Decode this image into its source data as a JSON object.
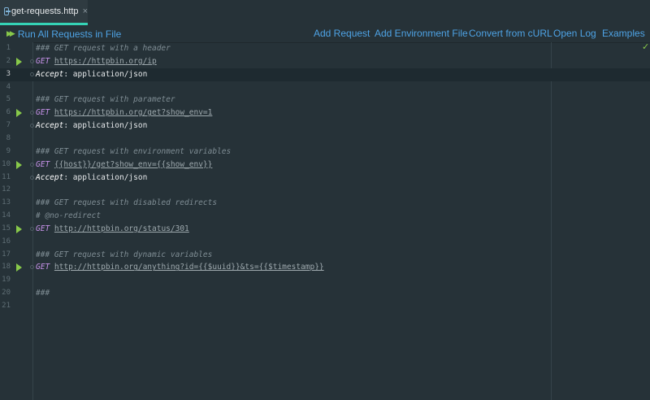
{
  "tab": {
    "title": "get-requests.http",
    "close": "×"
  },
  "toolbar": {
    "run_all": "Run All Requests in File",
    "add_request": "Add Request",
    "add_environment_file": "Add Environment File",
    "convert_from_curl": "Convert from cURL",
    "open_log": "Open Log",
    "examples": "Examples"
  },
  "editor": {
    "check": "✓",
    "lines": [
      {
        "n": "1",
        "comment": "### GET request with a header"
      },
      {
        "n": "2",
        "method": "GET",
        "url": "https://httpbin.org/ip",
        "run": true
      },
      {
        "n": "3",
        "header": "Accept",
        "value": "application/json",
        "current": true
      },
      {
        "n": "4"
      },
      {
        "n": "5",
        "comment": "### GET request with parameter"
      },
      {
        "n": "6",
        "method": "GET",
        "url": "https://httpbin.org/get?show_env=1",
        "run": true
      },
      {
        "n": "7",
        "header": "Accept",
        "value": "application/json"
      },
      {
        "n": "8"
      },
      {
        "n": "9",
        "comment": "### GET request with environment variables"
      },
      {
        "n": "10",
        "method": "GET",
        "url": "{{host}}/get?show_env={{show_env}}",
        "run": true
      },
      {
        "n": "11",
        "header": "Accept",
        "value": "application/json"
      },
      {
        "n": "12"
      },
      {
        "n": "13",
        "comment": "### GET request with disabled redirects"
      },
      {
        "n": "14",
        "comment": "# @no-redirect"
      },
      {
        "n": "15",
        "method": "GET",
        "url": "http://httpbin.org/status/301",
        "run": true
      },
      {
        "n": "16"
      },
      {
        "n": "17",
        "comment": "### GET request with dynamic variables"
      },
      {
        "n": "18",
        "method": "GET",
        "url": "http://httpbin.org/anything?id={{$uuid}}&ts={{$timestamp}}",
        "run": true
      },
      {
        "n": "19"
      },
      {
        "n": "20",
        "comment": "###"
      },
      {
        "n": "21"
      }
    ]
  }
}
